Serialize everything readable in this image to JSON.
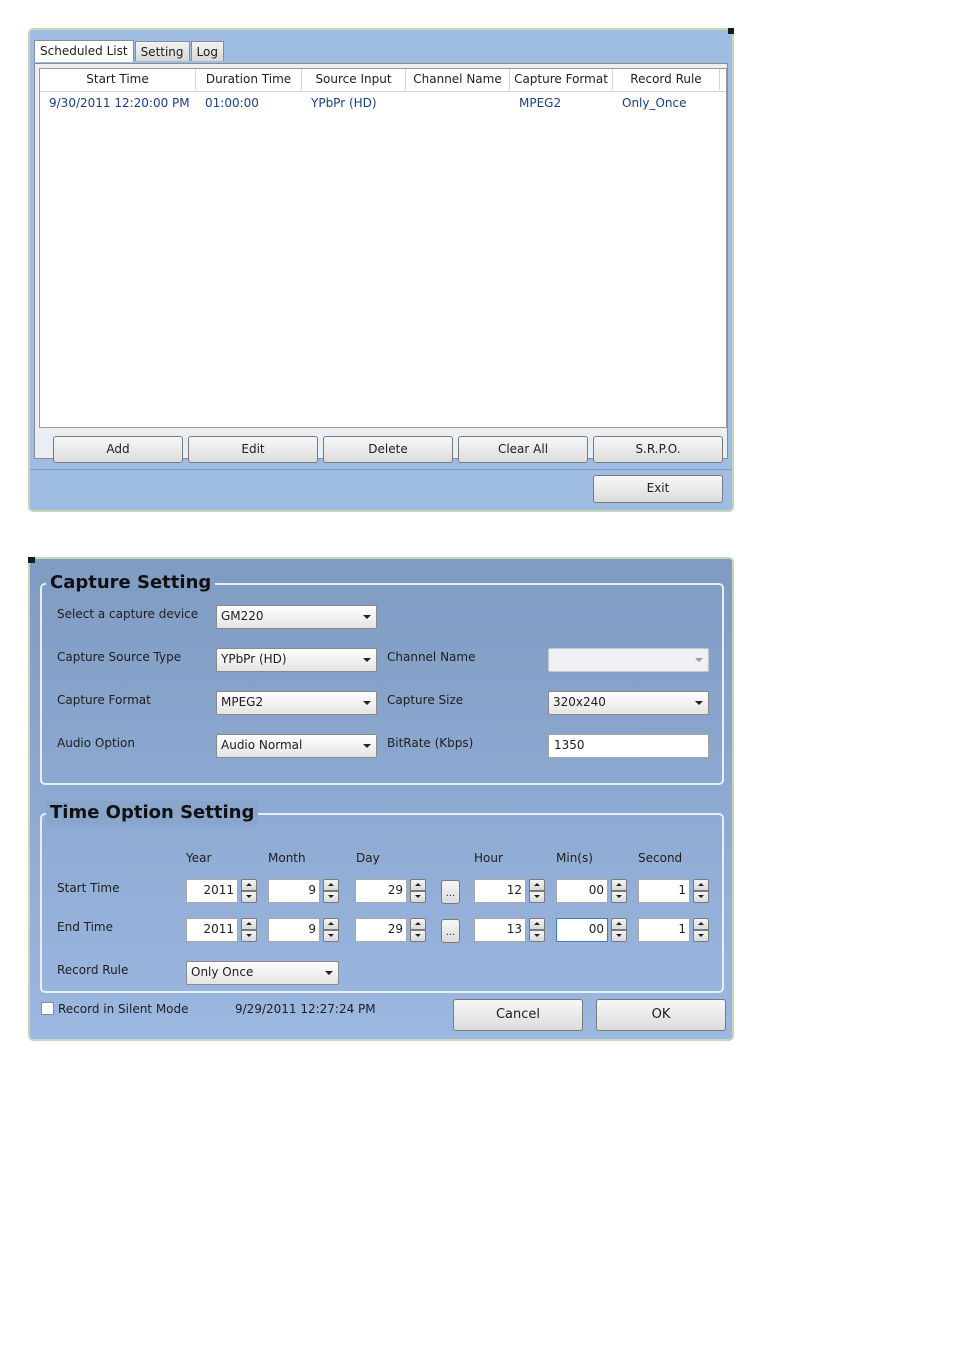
{
  "scheduled_window": {
    "tabs": [
      "Scheduled List",
      "Setting",
      "Log"
    ],
    "columns": [
      "Start Time",
      "Duration Time",
      "Source Input",
      "Channel Name",
      "Capture Format",
      "Record Rule"
    ],
    "rows": [
      [
        "9/30/2011 12:20:00 PM",
        "01:00:00",
        "YPbPr (HD)",
        "",
        "MPEG2",
        "Only_Once"
      ]
    ],
    "buttons": {
      "add": "Add",
      "edit": "Edit",
      "delete": "Delete",
      "clear_all": "Clear All",
      "srpo": "S.R.P.O.",
      "exit": "Exit"
    }
  },
  "setting_window": {
    "capture_setting": {
      "title": "Capture Setting",
      "device_label": "Select a capture device",
      "device_value": "GM220",
      "source_type_label": "Capture Source Type",
      "source_type_value": "YPbPr (HD)",
      "channel_name_label": "Channel Name",
      "channel_name_value": "",
      "format_label": "Capture Format",
      "format_value": "MPEG2",
      "size_label": "Capture Size",
      "size_value": "320x240",
      "audio_label": "Audio Option",
      "audio_value": "Audio Normal",
      "bitrate_label": "BitRate (Kbps)",
      "bitrate_value": "1350"
    },
    "time_option": {
      "title": "Time Option Setting",
      "headers": {
        "year": "Year",
        "month": "Month",
        "day": "Day",
        "hour": "Hour",
        "minute": "Min(s)",
        "second": "Second"
      },
      "start_label": "Start Time",
      "start": {
        "year": "2011",
        "month": "9",
        "day": "29",
        "hour": "12",
        "minute": "00",
        "second": "1"
      },
      "end_label": "End Time",
      "end": {
        "year": "2011",
        "month": "9",
        "day": "29",
        "hour": "13",
        "minute": "00",
        "second": "1"
      },
      "dots_label": "...",
      "record_rule_label": "Record Rule",
      "record_rule_value": "Only Once"
    },
    "silent_mode_label": "Record in Silent Mode",
    "silent_mode_checked": false,
    "current_time": "9/29/2011 12:27:24 PM",
    "buttons": {
      "cancel": "Cancel",
      "ok": "OK"
    }
  }
}
